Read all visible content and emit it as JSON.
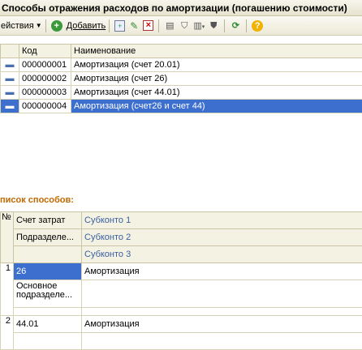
{
  "window": {
    "title": "Способы отражения расходов по амортизации (погашению стоимости)"
  },
  "toolbar": {
    "actions_label": "ействия",
    "add_label": "Добавить",
    "icons": [
      "copy-icon",
      "edit-icon",
      "delete-icon",
      "filter-icon",
      "filter-setting-icon",
      "filter-list-icon",
      "clear-filter-icon",
      "refresh-icon",
      "help-icon"
    ]
  },
  "list_table": {
    "columns": [
      "Код",
      "Наименование"
    ],
    "rows": [
      {
        "code": "000000001",
        "name": "Амортизация (счет 20.01)"
      },
      {
        "code": "000000002",
        "name": "Амортизация (счет 26)"
      },
      {
        "code": "000000003",
        "name": "Амортизация (счет 44.01)"
      },
      {
        "code": "000000004",
        "name": "Амортизация (счет26 и счет 44)",
        "selected": true
      }
    ]
  },
  "methods": {
    "section_title": "писок способов:",
    "header": {
      "num": "№",
      "account": "Счет затрат",
      "subdivision": "Подразделе...",
      "subconto1": "Субконто 1",
      "subconto2": "Субконто 2",
      "subconto3": "Субконто 3"
    },
    "rows": [
      {
        "num": "1",
        "account": "26",
        "subdivision": "Основное подразделе...",
        "subconto1": "Амортизация",
        "subconto2": "",
        "subconto3": ""
      },
      {
        "num": "2",
        "account": "44.01",
        "subdivision": "",
        "subconto1": "Амортизация",
        "subconto2": "",
        "subconto3": ""
      }
    ]
  },
  "colors": {
    "selection": "#3d6fcf",
    "section_title": "#c06a00",
    "header_bg": "#f4f2e3"
  }
}
